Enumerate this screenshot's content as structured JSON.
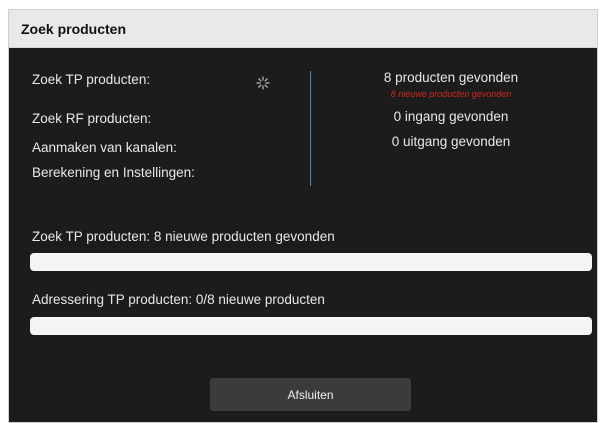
{
  "dialog": {
    "title": "Zoek producten"
  },
  "steps": [
    {
      "label": "Zoek TP producten:"
    },
    {
      "label": "Zoek RF producten:"
    },
    {
      "label": "Aanmaken van kanalen:"
    },
    {
      "label": "Berekening en Instellingen:"
    }
  ],
  "results": {
    "found": "8 producten gevonden",
    "found_sub": "8 nieuwe producten gevonden",
    "ingang": "0 ingang gevonden",
    "uitgang": "0 uitgang gevonden"
  },
  "progress": [
    {
      "label": "Zoek TP producten: 8 nieuwe producten gevonden",
      "fraction": 0
    },
    {
      "label": "Adressering TP producten: 0/8 nieuwe producten",
      "fraction": 0
    }
  ],
  "buttons": {
    "close_label": "Afsluiten"
  },
  "icons": {
    "spinner": "loading-spinner-icon"
  },
  "colors": {
    "accent": "#3f86d4",
    "alert": "#d2281e",
    "background": "#1c1c1c"
  }
}
